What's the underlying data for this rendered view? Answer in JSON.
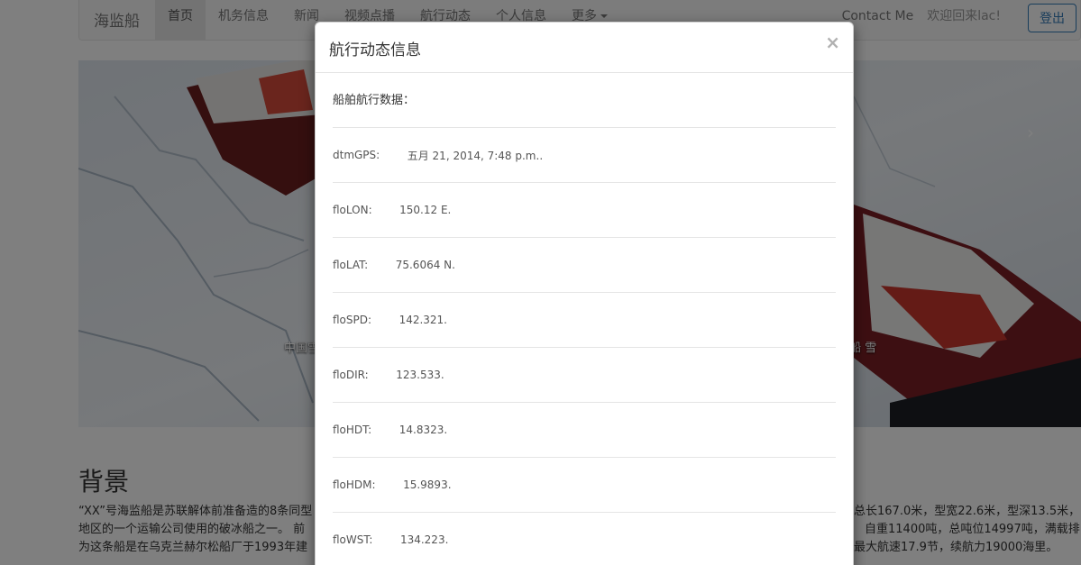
{
  "navbar": {
    "brand": "海监船",
    "items": [
      {
        "label": "首页",
        "active": true
      },
      {
        "label": "机务信息"
      },
      {
        "label": "新闻"
      },
      {
        "label": "视频点播"
      },
      {
        "label": "航行动态"
      },
      {
        "label": "个人信息"
      },
      {
        "label": "更多"
      }
    ],
    "contact": "Contact Me",
    "welcome": "欢迎回来lac!",
    "logout": "登出"
  },
  "carousel": {
    "next_glyph": "›",
    "caption_left": "中国雪",
    "caption_right": "(船  雪"
  },
  "background": {
    "heading": "背景",
    "left_lines": [
      "“XX”号海监船是苏联解体前准备造的8条同型",
      "地区的一个运输公司使用的破冰船之一。 前",
      "为这条船是在乌克兰赫尔松船厂于1993年建"
    ],
    "right_lines": [
      "总长167.0米，型宽22.6米，型深13.5米，",
      "自重11400吨，总吨位14997吨，满载排",
      "最大航速17.9节，续航力19000海里。"
    ]
  },
  "modal": {
    "title": "航行动态信息",
    "close": "×",
    "subhead": "船舶航行数据：",
    "rows": [
      {
        "label": "dtmGPS:",
        "gap": "        ",
        "value": "五月 21, 2014, 7:48 p.m.."
      },
      {
        "label": "floLON:",
        "gap": "        ",
        "value": "150.12 E."
      },
      {
        "label": "floLAT:",
        "gap": "        ",
        "value": "75.6064 N."
      },
      {
        "label": "floSPD:",
        "gap": "        ",
        "value": "142.321."
      },
      {
        "label": "floDIR:",
        "gap": "        ",
        "value": "123.533."
      },
      {
        "label": "floHDT:",
        "gap": "        ",
        "value": "14.8323."
      },
      {
        "label": "floHDM:",
        "gap": "        ",
        "value": "15.9893."
      },
      {
        "label": "floWST:",
        "gap": "        ",
        "value": "134.223."
      }
    ]
  }
}
